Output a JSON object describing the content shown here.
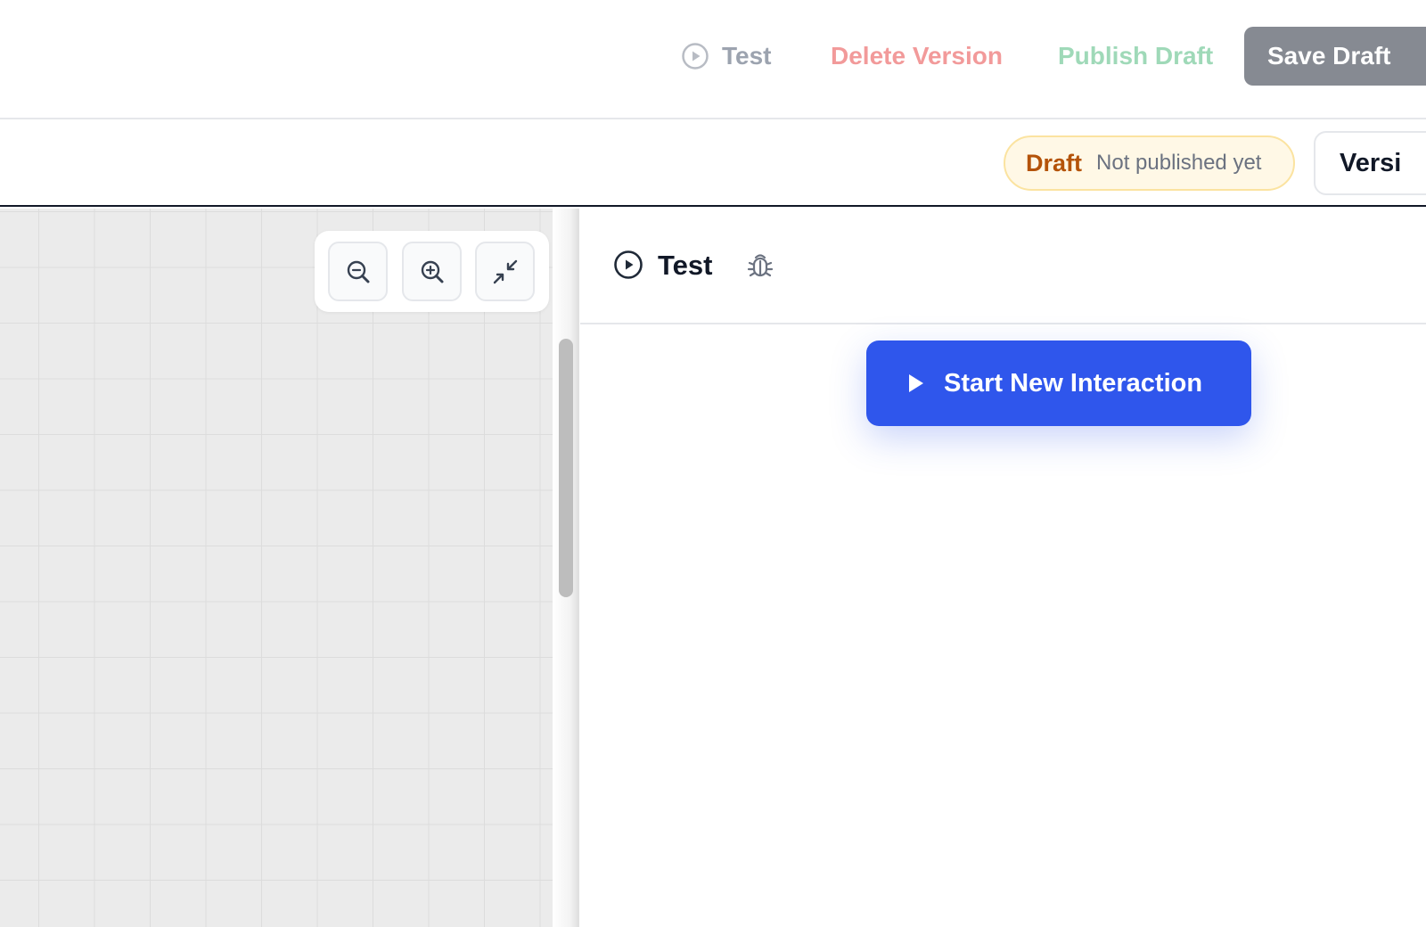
{
  "toolbar": {
    "test_label": "Test",
    "delete_label": "Delete Version",
    "publish_label": "Publish Draft",
    "save_label": "Save Draft"
  },
  "status": {
    "draft_label": "Draft",
    "draft_sub": "Not published yet",
    "version_label": "Versi"
  },
  "canvas": {
    "zoom_controls": [
      {
        "icon": "zoom-out-icon"
      },
      {
        "icon": "zoom-in-icon"
      },
      {
        "icon": "collapse-icon"
      }
    ]
  },
  "test_panel": {
    "title": "Test",
    "icons": [
      "play-circle-icon",
      "bug-icon"
    ],
    "start_button_label": "Start New Interaction",
    "start_button_icon": "play-icon"
  },
  "colors": {
    "delete": "#f29a9a",
    "publish": "#9fd9b8",
    "save_bg": "#868a92",
    "draft_text": "#b45309",
    "primary": "#2f56ec"
  }
}
